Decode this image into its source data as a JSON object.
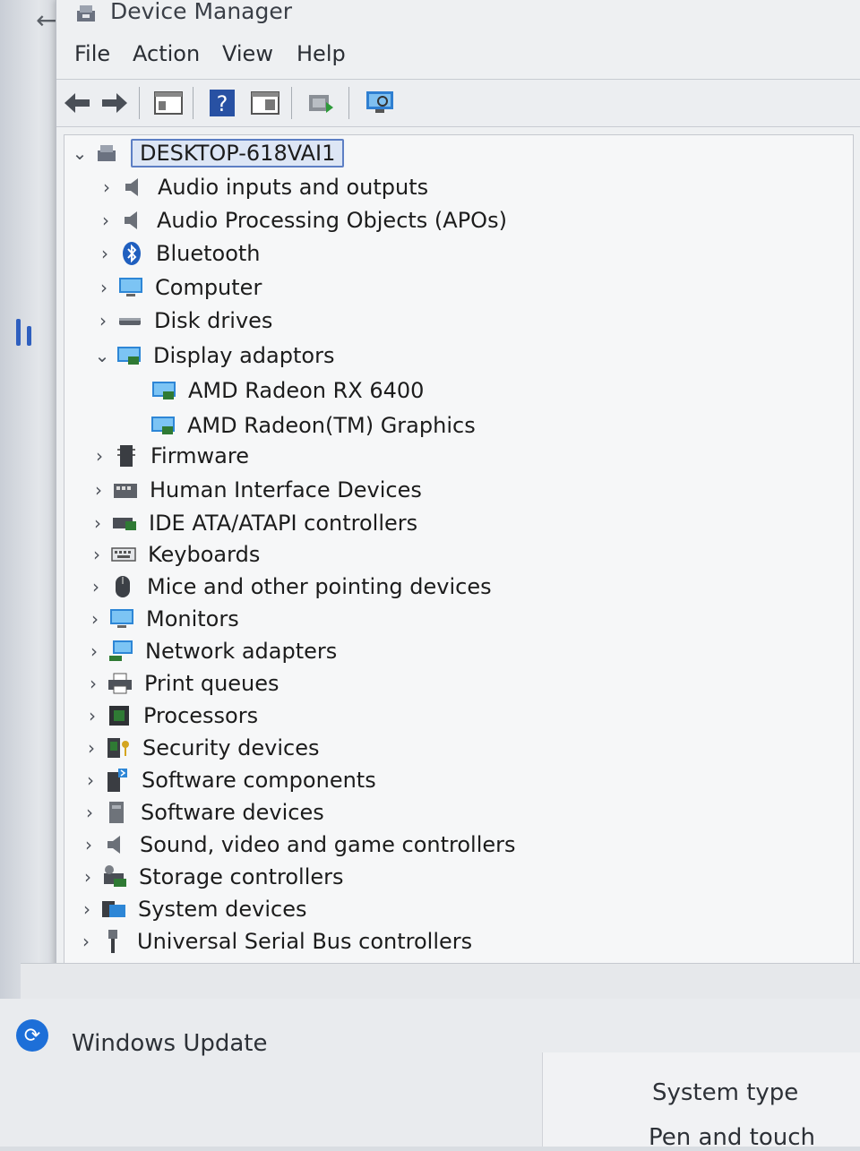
{
  "window": {
    "title": "Device Manager"
  },
  "menu": [
    "File",
    "Action",
    "View",
    "Help"
  ],
  "toolbar": [
    "back-icon",
    "forward-icon",
    "properties-icon",
    "help-icon",
    "show-hide-icon",
    "update-driver-icon",
    "scan-hardware-icon"
  ],
  "tree": {
    "root": "DESKTOP-618VAI1",
    "categories": [
      {
        "label": "Audio inputs and outputs",
        "icon": "speaker-icon",
        "expanded": false
      },
      {
        "label": "Audio Processing Objects (APOs)",
        "icon": "speaker-icon",
        "expanded": false
      },
      {
        "label": "Bluetooth",
        "icon": "bluetooth-icon",
        "expanded": false
      },
      {
        "label": "Computer",
        "icon": "computer-icon",
        "expanded": false
      },
      {
        "label": "Disk drives",
        "icon": "disk-icon",
        "expanded": false
      },
      {
        "label": "Display adaptors",
        "icon": "display-adapter-icon",
        "expanded": true,
        "children": [
          "AMD Radeon RX 6400",
          "AMD Radeon(TM) Graphics"
        ]
      },
      {
        "label": "Firmware",
        "icon": "firmware-icon",
        "expanded": false
      },
      {
        "label": "Human Interface Devices",
        "icon": "hid-icon",
        "expanded": false
      },
      {
        "label": "IDE ATA/ATAPI controllers",
        "icon": "ide-icon",
        "expanded": false
      },
      {
        "label": "Keyboards",
        "icon": "keyboard-icon",
        "expanded": false
      },
      {
        "label": "Mice and other pointing devices",
        "icon": "mouse-icon",
        "expanded": false
      },
      {
        "label": "Monitors",
        "icon": "monitor-icon",
        "expanded": false
      },
      {
        "label": "Network adapters",
        "icon": "network-icon",
        "expanded": false
      },
      {
        "label": "Print queues",
        "icon": "printer-icon",
        "expanded": false
      },
      {
        "label": "Processors",
        "icon": "processor-icon",
        "expanded": false
      },
      {
        "label": "Security devices",
        "icon": "security-icon",
        "expanded": false
      },
      {
        "label": "Software components",
        "icon": "software-component-icon",
        "expanded": false
      },
      {
        "label": "Software devices",
        "icon": "software-device-icon",
        "expanded": false
      },
      {
        "label": "Sound, video and game controllers",
        "icon": "speaker-icon",
        "expanded": false
      },
      {
        "label": "Storage controllers",
        "icon": "storage-icon",
        "expanded": false
      },
      {
        "label": "System devices",
        "icon": "system-folder-icon",
        "expanded": false
      },
      {
        "label": "Universal Serial Bus controllers",
        "icon": "usb-icon",
        "expanded": false
      }
    ]
  },
  "background": {
    "windows_update": "Windows Update",
    "system_type": "System type",
    "pen_touch": "Pen and touch"
  },
  "colors": {
    "accent": "#1d6fd8",
    "selection_border": "#5d7fc4"
  }
}
